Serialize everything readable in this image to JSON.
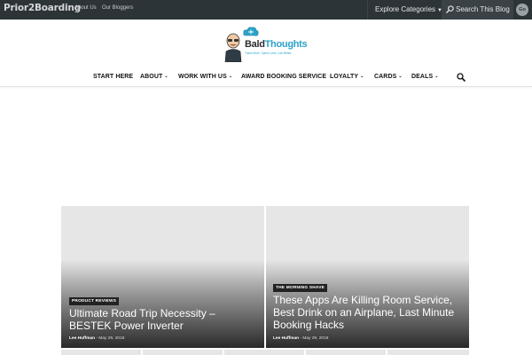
{
  "topbar": {
    "brand": "Prior2Boarding",
    "links": [
      "About Us",
      "Our Bloggers"
    ],
    "explore_label": "Explore Categories",
    "search_placeholder": "Search This Blog",
    "go_label": "Go"
  },
  "logo": {
    "wordmark_main": "Bald",
    "wordmark_accent": "Thoughts",
    "tagline": "Travel More. Spend Less. Live Better."
  },
  "nav": {
    "items": [
      {
        "label": "START HERE",
        "dropdown": false
      },
      {
        "label": "ABOUT",
        "dropdown": true
      },
      {
        "label": "WORK WITH US",
        "dropdown": true
      },
      {
        "label": "AWARD BOOKING SERVICE",
        "dropdown": false
      },
      {
        "label": "LOYALTY",
        "dropdown": true
      },
      {
        "label": "CARDS",
        "dropdown": true
      },
      {
        "label": "DEALS",
        "dropdown": true
      }
    ],
    "search_icon": "search-icon"
  },
  "features": [
    {
      "category": "PRODUCT REVIEWS",
      "title": "Ultimate Road Trip Necessity – BESTEK Power Inverter",
      "author": "Lee Huffman",
      "date": "May 29, 2018"
    },
    {
      "category": "THE MORNING SHAVE",
      "title": "These Apps Are Killing Room Service, Best Drink on an Airplane, Last Minute Booking Hacks",
      "author": "Lee Huffman",
      "date": "May 29, 2018"
    }
  ],
  "colors": {
    "topbar_bg": "#2d3438",
    "accent": "#2aa3c8",
    "tile_bg": "#e6e6e6"
  }
}
